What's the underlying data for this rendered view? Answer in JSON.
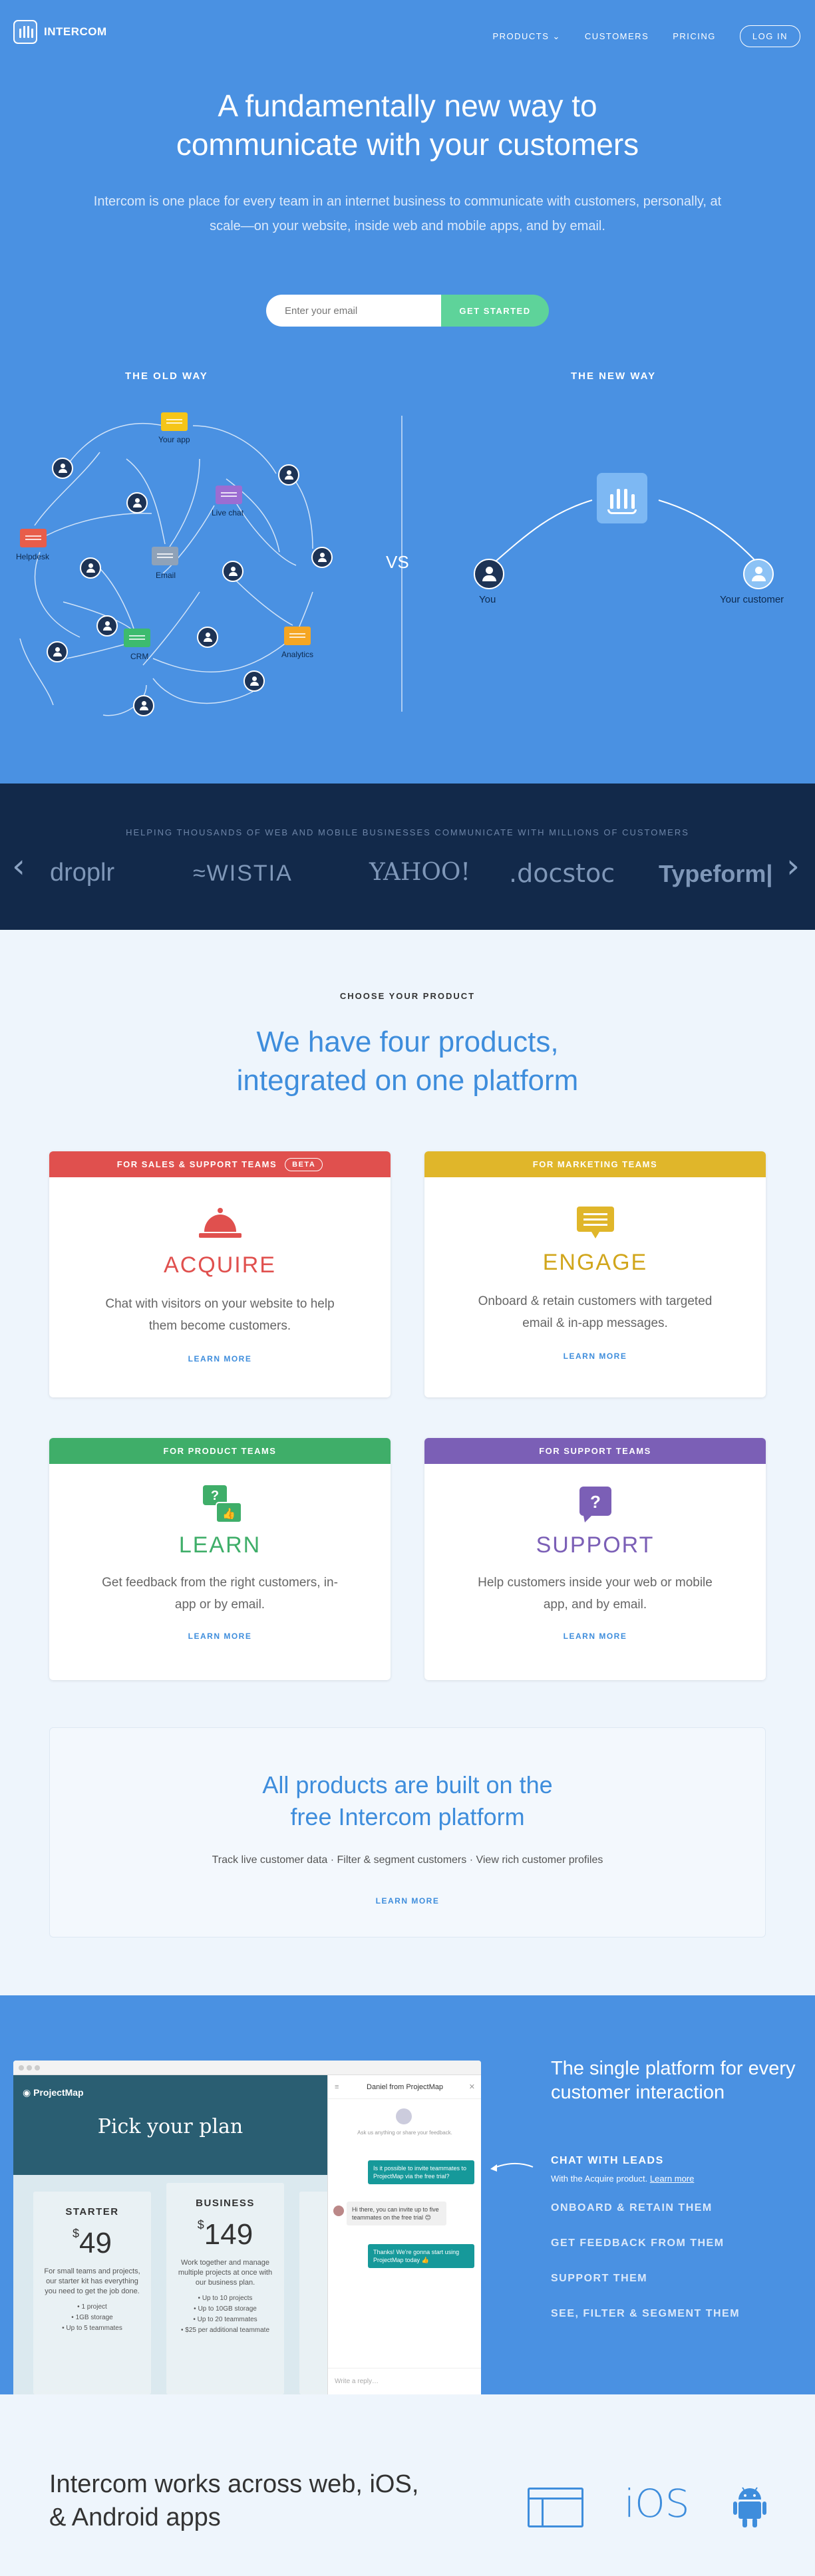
{
  "brand": {
    "name": "INTERCOM"
  },
  "nav": {
    "products": "PRODUCTS",
    "customers": "CUSTOMERS",
    "pricing": "PRICING",
    "login": "LOG IN"
  },
  "hero": {
    "title_line1": "A fundamentally new way to",
    "title_line2": "communicate with your customers",
    "subtitle": "Intercom is one place for every team in an internet business to communicate with customers, personally, at scale—on your website, inside web and mobile apps, and by email.",
    "email_placeholder": "Enter your email",
    "cta": "GET STARTED"
  },
  "comparison": {
    "old_title": "THE OLD WAY",
    "new_title": "THE NEW WAY",
    "vs": "VS",
    "old_tools": [
      "Your app",
      "Live chat",
      "Helpdesk",
      "Email",
      "CRM",
      "Analytics"
    ],
    "you": "You",
    "your_customer": "Your customer",
    "colors": {
      "your_app": "#f5c518",
      "live_chat": "#9b6dd2",
      "helpdesk": "#e85d4a",
      "email": "#8fa2b8",
      "crm": "#3dbb6e",
      "analytics": "#f5a623"
    }
  },
  "customers": {
    "caption": "HELPING THOUSANDS OF WEB AND MOBILE BUSINESSES COMMUNICATE WITH MILLIONS OF CUSTOMERS",
    "logos": [
      "droplr",
      "WISTIA",
      "YAHOO!",
      "docstoc",
      "Typeform"
    ],
    "prev_icon": "chevron-left-icon",
    "next_icon": "chevron-right-icon"
  },
  "products": {
    "eyebrow": "CHOOSE YOUR PRODUCT",
    "title_line1": "We have four products,",
    "title_line2": "integrated on one platform",
    "cards": [
      {
        "header": "FOR SALES & SUPPORT TEAMS",
        "badge": "BETA",
        "name": "ACQUIRE",
        "desc": "Chat with visitors on your website to help them become customers.",
        "more": "LEARN MORE",
        "color": "#e0504e",
        "icon": "bell-icon"
      },
      {
        "header": "FOR MARKETING TEAMS",
        "name": "ENGAGE",
        "desc": "Onboard & retain customers with targeted email & in-app messages.",
        "more": "LEARN MORE",
        "color": "#e0b62a",
        "icon": "message-icon"
      },
      {
        "header": "FOR PRODUCT TEAMS",
        "name": "LEARN",
        "desc": "Get feedback from the right customers, in-app or by email.",
        "more": "LEARN MORE",
        "color": "#3fae69",
        "icon": "feedback-icon"
      },
      {
        "header": "FOR SUPPORT TEAMS",
        "name": "SUPPORT",
        "desc": "Help customers inside your web or mobile app, and by email.",
        "more": "LEARN MORE",
        "color": "#7b5fb6",
        "icon": "question-icon"
      }
    ],
    "platform": {
      "title_line1": "All products are built on the",
      "title_line2": "free Intercom platform",
      "features": "Track live customer data  ·  Filter & segment customers  ·  View rich customer profiles",
      "more": "LEARN MORE"
    }
  },
  "single": {
    "title": "The single platform for every customer interaction",
    "items": [
      {
        "label": "CHAT WITH LEADS",
        "note": "With the Acquire product.",
        "link": "Learn more"
      },
      {
        "label": "ONBOARD & RETAIN THEM"
      },
      {
        "label": "GET FEEDBACK FROM THEM"
      },
      {
        "label": "SUPPORT THEM"
      },
      {
        "label": "SEE, FILTER & SEGMENT THEM"
      }
    ],
    "screenshot": {
      "site_name": "ProjectMap",
      "headline": "Pick your plan",
      "plans": [
        {
          "name": "STARTER",
          "price": "49",
          "desc": "For small teams and projects, our starter kit has everything you need to get the job done.",
          "features": [
            "1 project",
            "1GB storage",
            "Up to 5 teammates"
          ]
        },
        {
          "name": "BUSINESS",
          "price": "149",
          "desc": "Work together and manage multiple projects at once with our business plan.",
          "features": [
            "Up to 10 projects",
            "Up to 10GB storage",
            "Up to 20 teammates",
            "$25 per additional teammate"
          ]
        }
      ],
      "chat_header": "Daniel from ProjectMap",
      "chat_intro": "Ask us anything or share your feedback.",
      "msg1": "Is it possible to invite teammates to ProjectMap via the free trial?",
      "msg2": "Hi there, you can invite up to five teammates on the free trial 😊",
      "msg3": "Thanks! We're gonna start using ProjectMap today 👍",
      "write_placeholder": "Write a reply…"
    }
  },
  "apps": {
    "title_line1": "Intercom works across web, iOS,",
    "title_line2": "& Android apps",
    "ios": "iOS"
  }
}
